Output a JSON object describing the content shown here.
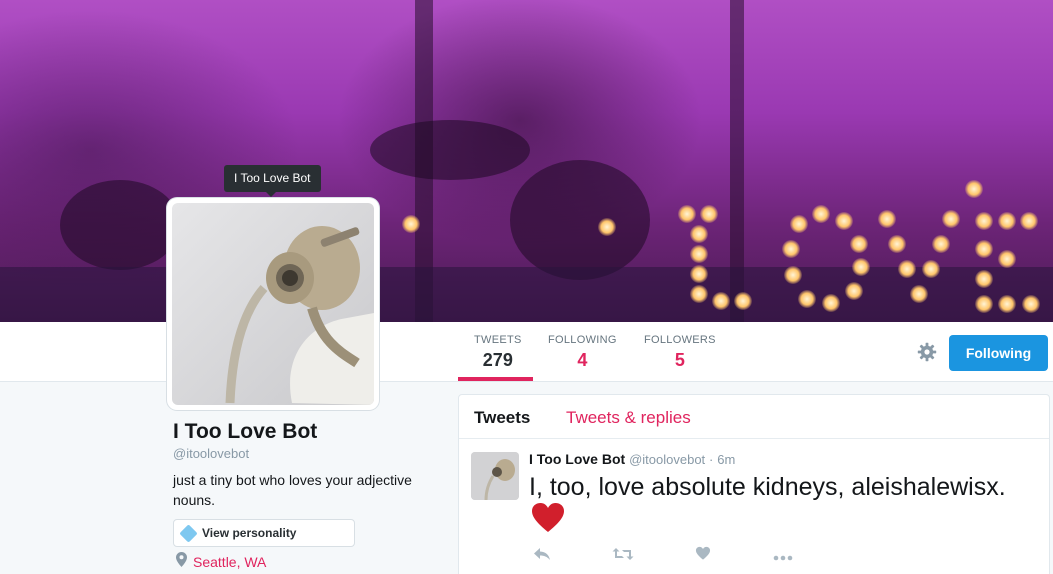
{
  "profile": {
    "name": "I Too Love Bot",
    "handle": "@itoolovebot",
    "bio": "just a tiny bot who loves your adjective nouns.",
    "location": "Seattle, WA",
    "personality_button": "View personality",
    "tooltip": "I Too Love Bot",
    "avatar_icon": "gas-mask-figure",
    "location_icon": "map-pin-icon"
  },
  "stats": {
    "tweets": {
      "label": "TWEETS",
      "value": "279"
    },
    "following": {
      "label": "FOLLOWING",
      "value": "4"
    },
    "followers": {
      "label": "FOLLOWERS",
      "value": "5"
    }
  },
  "actions": {
    "follow_button": "Following",
    "settings_icon": "gear-icon"
  },
  "timeline": {
    "tabs": [
      {
        "label": "Tweets",
        "active": true
      },
      {
        "label": "Tweets & replies",
        "active": false
      }
    ],
    "tweets": [
      {
        "name": "I Too Love Bot",
        "handle": "@itoolovebot",
        "separator": "·",
        "time": "6m",
        "text": "I, too, love absolute kidneys, aleishalewisx.",
        "emoji": "red-heart",
        "action_icons": [
          "reply-icon",
          "retweet-icon",
          "like-icon",
          "more-icon"
        ]
      }
    ]
  },
  "colors": {
    "accent": "#e0245e",
    "follow_button": "#1b95e0",
    "banner_tint": "#9a39b2"
  }
}
